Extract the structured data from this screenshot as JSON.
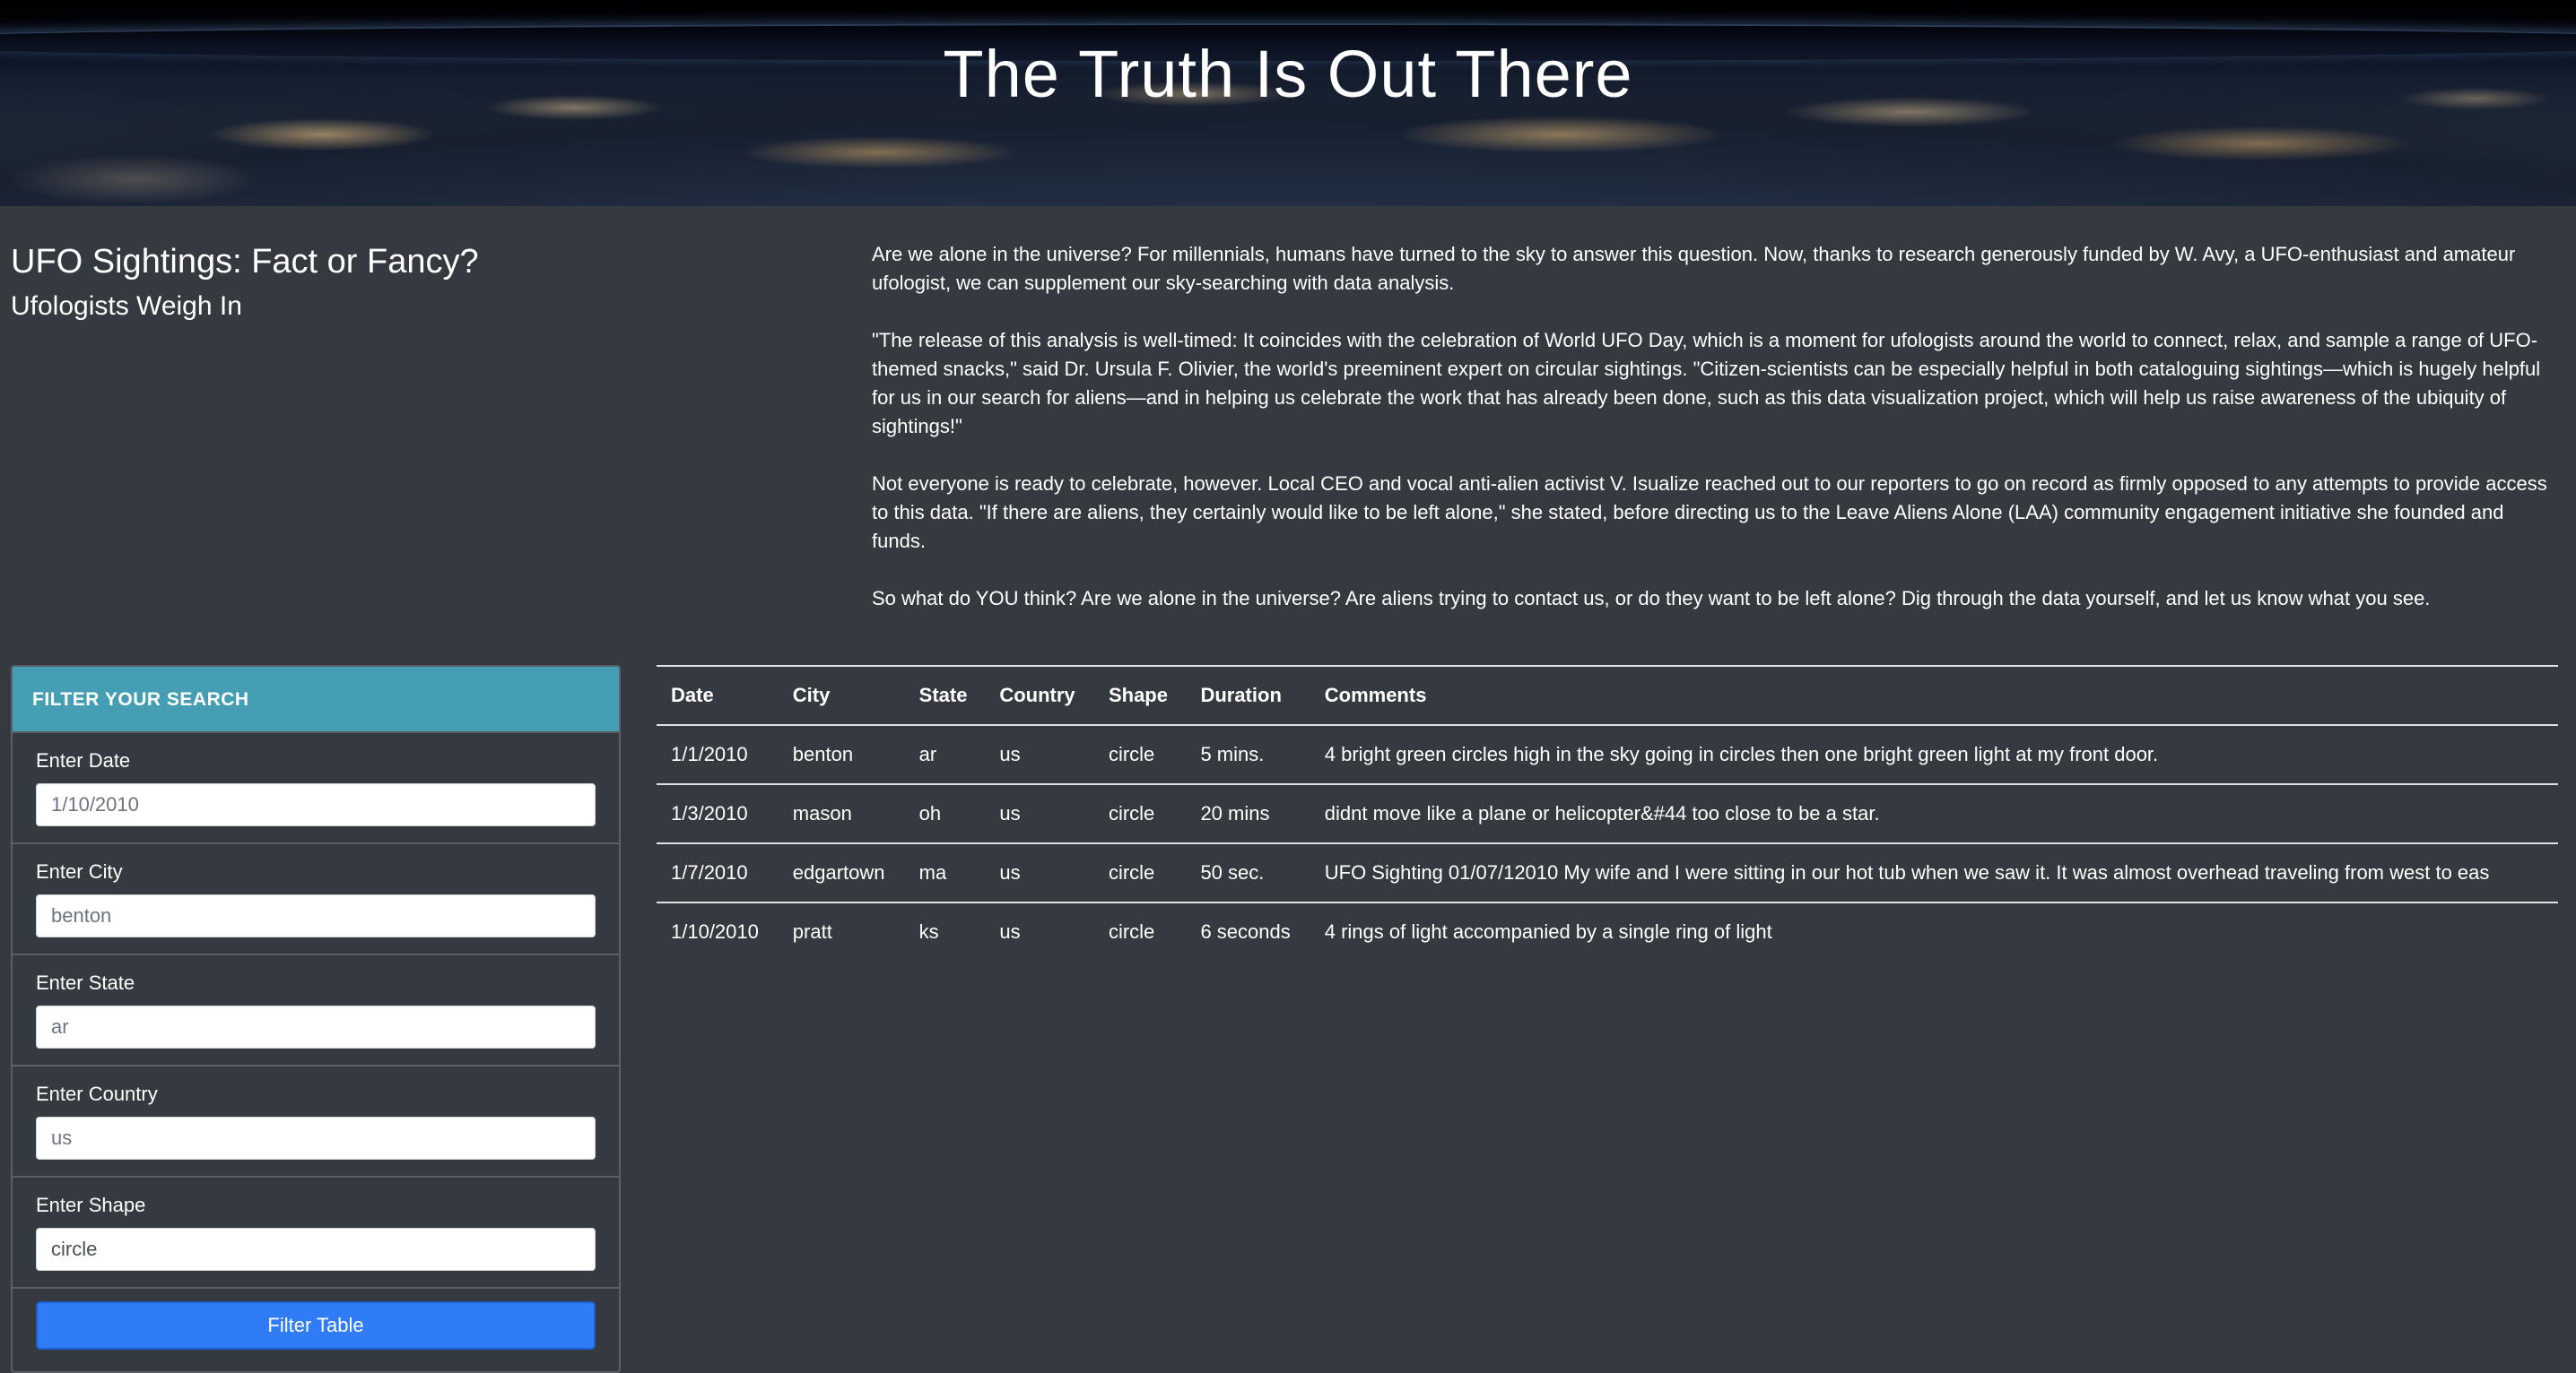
{
  "hero": {
    "title": "The Truth Is Out There"
  },
  "intro": {
    "title": "UFO Sightings: Fact or Fancy?",
    "subtitle": "Ufologists Weigh In",
    "paragraphs": [
      "Are we alone in the universe? For millennials, humans have turned to the sky to answer this question. Now, thanks to research generously funded by W. Avy, a UFO-enthusiast and amateur ufologist, we can supplement our sky-searching with data analysis.",
      "\"The release of this analysis is well-timed: It coincides with the celebration of World UFO Day, which is a moment for ufologists around the world to connect, relax, and sample a range of UFO-themed snacks,\" said Dr. Ursula F. Olivier, the world's preeminent expert on circular sightings. \"Citizen-scientists can be especially helpful in both cataloguing sightings—which is hugely helpful for us in our search for aliens—and in helping us celebrate the work that has already been done, such as this data visualization project, which will help us raise awareness of the ubiquity of sightings!\"",
      "Not everyone is ready to celebrate, however. Local CEO and vocal anti-alien activist V. Isualize reached out to our reporters to go on record as firmly opposed to any attempts to provide access to this data. \"If there are aliens, they certainly would like to be left alone,\" she stated, before directing us to the Leave Aliens Alone (LAA) community engagement initiative she founded and funds.",
      "So what do YOU think? Are we alone in the universe? Are aliens trying to contact us, or do they want to be left alone? Dig through the data yourself, and let us know what you see."
    ]
  },
  "filters": {
    "header": "FILTER YOUR SEARCH",
    "date": {
      "label": "Enter Date",
      "placeholder": "1/10/2010"
    },
    "city": {
      "label": "Enter City",
      "placeholder": "benton"
    },
    "state": {
      "label": "Enter State",
      "placeholder": "ar"
    },
    "country": {
      "label": "Enter Country",
      "placeholder": "us"
    },
    "shape": {
      "label": "Enter Shape",
      "value": "circle"
    },
    "button_label": "Filter Table"
  },
  "table": {
    "columns": [
      "Date",
      "City",
      "State",
      "Country",
      "Shape",
      "Duration",
      "Comments"
    ],
    "rows": [
      [
        "1/1/2010",
        "benton",
        "ar",
        "us",
        "circle",
        "5 mins.",
        "4 bright green circles high in the sky going in circles then one bright green light at my front door."
      ],
      [
        "1/3/2010",
        "mason",
        "oh",
        "us",
        "circle",
        "20 mins",
        "didnt move like a plane or helicopter&#44 too close to be a star."
      ],
      [
        "1/7/2010",
        "edgartown",
        "ma",
        "us",
        "circle",
        "50 sec.",
        "UFO Sighting 01/07/12010 My wife and I were sitting in our hot tub when we saw it. It was almost overhead traveling from west to eas"
      ],
      [
        "1/10/2010",
        "pratt",
        "ks",
        "us",
        "circle",
        "6 seconds",
        "4 rings of light accompanied by a single ring of light"
      ]
    ]
  }
}
